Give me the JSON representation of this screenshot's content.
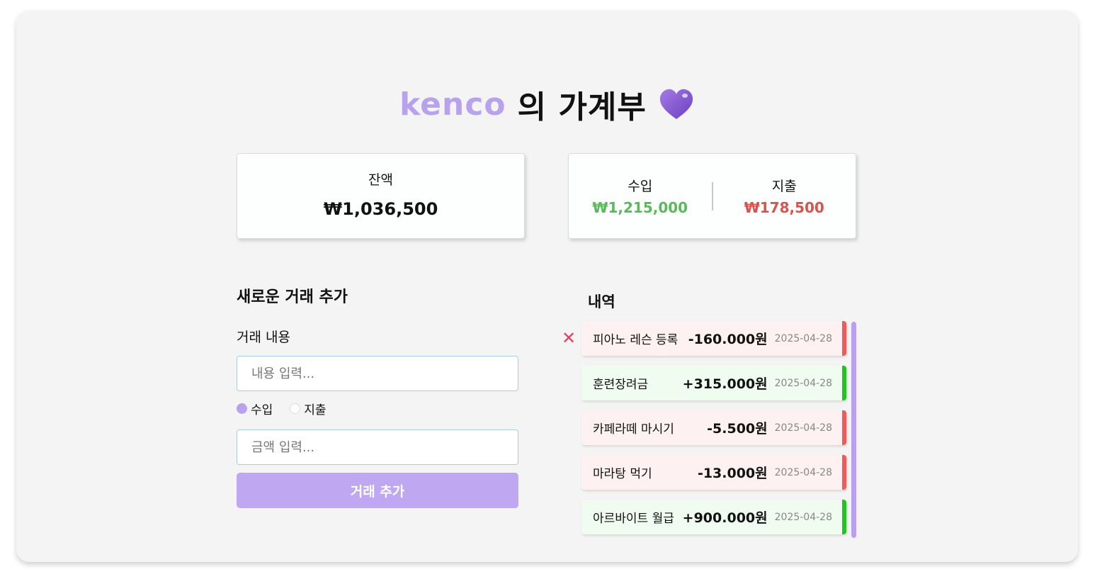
{
  "header": {
    "name": "kenco",
    "title_rest": "의 가계부",
    "heart_icon": "purple-heart-icon"
  },
  "balance": {
    "label": "잔액",
    "value": "₩1,036,500"
  },
  "summary": {
    "income_label": "수입",
    "income_value": "₩1,215,000",
    "expense_label": "지출",
    "expense_value": "₩178,500"
  },
  "form": {
    "title": "새로운 거래 추가",
    "desc_label": "거래 내용",
    "desc_placeholder": "내용 입력...",
    "radio_income": "수입",
    "radio_expense": "지출",
    "selected_type": "수입",
    "amount_placeholder": "금액 입력...",
    "submit_label": "거래 추가"
  },
  "history": {
    "title": "내역",
    "delete_glyph": "✕",
    "items": [
      {
        "desc": "피아노 레슨 등록",
        "amount": "-160.000원",
        "date": "2025-04-28",
        "type": "minus"
      },
      {
        "desc": "훈련장려금",
        "amount": "+315.000원",
        "date": "2025-04-28",
        "type": "plus"
      },
      {
        "desc": "카페라떼 마시기",
        "amount": "-5.500원",
        "date": "2025-04-28",
        "type": "minus"
      },
      {
        "desc": "마라탕 먹기",
        "amount": "-13.000원",
        "date": "2025-04-28",
        "type": "minus"
      },
      {
        "desc": "아르바이트 월급",
        "amount": "+900.000원",
        "date": "2025-04-28",
        "type": "plus"
      }
    ]
  },
  "colors": {
    "accent": "#b8a2ee",
    "income": "#5cb85c",
    "expense": "#d9534f",
    "plus_bar": "#22c322",
    "minus_bar": "#f25a5a"
  }
}
